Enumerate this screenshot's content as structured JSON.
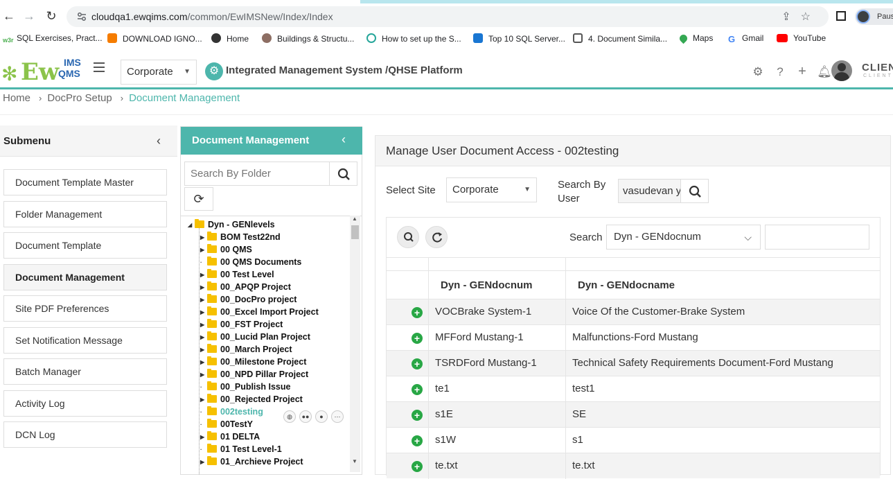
{
  "browser": {
    "url_domain": "cloudqa1.ewqims.com",
    "url_path": "/common/EwIMSNew/Index/Index",
    "profile_label": "Paus",
    "bookmarks": [
      {
        "label": "SQL Exercises, Pract...",
        "color": "#4caf50"
      },
      {
        "label": "DOWNLOAD IGNO...",
        "color": "#f57c00"
      },
      {
        "label": "Home",
        "color": "#333333"
      },
      {
        "label": "Buildings & Structu...",
        "color": "#8d6e63"
      },
      {
        "label": "How to set up the S...",
        "color": "#26a69a"
      },
      {
        "label": "Top 10 SQL Server...",
        "color": "#1976d2"
      },
      {
        "label": "4. Document Simila...",
        "color": "#555555"
      },
      {
        "label": "Maps",
        "color": "#34a853"
      },
      {
        "label": "Gmail",
        "color": "#ea4335"
      },
      {
        "label": "YouTube",
        "color": "#ff0000"
      }
    ]
  },
  "header": {
    "logo_main": "Ew",
    "logo_ims": "IMS",
    "logo_qms": "QMS",
    "site": "Corporate",
    "platform_title": "Integrated Management System /QHSE Platform",
    "client_name": "CLIENT",
    "client_sub": "CLIENT"
  },
  "breadcrumb": {
    "home": "Home",
    "setup": "DocPro Setup",
    "current": "Document Management"
  },
  "submenu": {
    "title": "Submenu",
    "items": [
      {
        "label": "Document Template Master",
        "active": false
      },
      {
        "label": "Folder Management",
        "active": false
      },
      {
        "label": "Document Template",
        "active": false
      },
      {
        "label": "Document Management",
        "active": true
      },
      {
        "label": "Site PDF Preferences",
        "active": false
      },
      {
        "label": "Set Notification Message",
        "active": false
      },
      {
        "label": "Batch Manager",
        "active": false
      },
      {
        "label": "Activity Log",
        "active": false
      },
      {
        "label": "DCN Log",
        "active": false
      }
    ]
  },
  "tree": {
    "title": "Document Management",
    "search_placeholder": "Search By Folder",
    "root": "Dyn - GENlevels",
    "nodes": [
      "BOM Test22nd",
      "00 QMS",
      "00 QMS Documents",
      "00 Test Level",
      "00_APQP Project",
      "00_DocPro project",
      "00_Excel Import Project",
      "00_FST Project",
      "00_Lucid Plan Project",
      "00_March Project",
      "00_Milestone Project",
      "00_NPD Pillar Project",
      "00_Publish Issue",
      "00_Rejected Project",
      "002testing",
      "00TestY",
      "01 DELTA",
      "01 Test Level-1",
      "01_Archieve Project"
    ],
    "selected": "002testing"
  },
  "main": {
    "title": "Manage User Document Access - 002testing",
    "select_site_label": "Select Site",
    "site_value": "Corporate",
    "search_by_user_label": "Search By User",
    "user_value": "vasudevan y",
    "grid_search_label": "Search",
    "grid_search_column": "Dyn - GENdocnum",
    "columns": [
      "Dyn - GENdocnum",
      "Dyn - GENdocname"
    ],
    "rows": [
      {
        "docnum": "VOCBrake System-1",
        "docname": "Voice Of the Customer-Brake System"
      },
      {
        "docnum": "MFFord Mustang-1",
        "docname": "Malfunctions-Ford Mustang"
      },
      {
        "docnum": "TSRDFord Mustang-1",
        "docname": "Technical Safety Requirements Document-Ford Mustang"
      },
      {
        "docnum": "te1",
        "docname": "test1"
      },
      {
        "docnum": "s1E",
        "docname": "SE"
      },
      {
        "docnum": "s1W",
        "docname": "s1"
      },
      {
        "docnum": "te.txt",
        "docname": "te.txt"
      }
    ]
  },
  "colors": {
    "accent": "#4db6ac",
    "add_green": "#28a745",
    "folder_yellow": "#f6c000"
  }
}
